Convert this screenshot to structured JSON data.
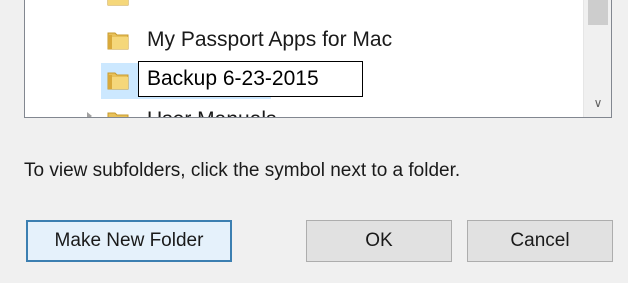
{
  "folder_tree": {
    "items": [
      {
        "label": "My Passport Apps for Mac",
        "icon": "folder-icon",
        "state": "normal"
      },
      {
        "label": "Backup 6-23-2015",
        "icon": "folder-icon",
        "state": "renaming"
      }
    ],
    "partial_top_label": "",
    "partial_bottom_label": "User Manuals",
    "scroll_down_glyph": "∨"
  },
  "hint_text": "To view subfolders, click the symbol next to a folder.",
  "buttons": {
    "make_new_folder": "Make New Folder",
    "ok": "OK",
    "cancel": "Cancel"
  },
  "colors": {
    "selection": "#cce8ff",
    "focus_border": "#3c7fb1",
    "folder": "#e8c15a"
  }
}
